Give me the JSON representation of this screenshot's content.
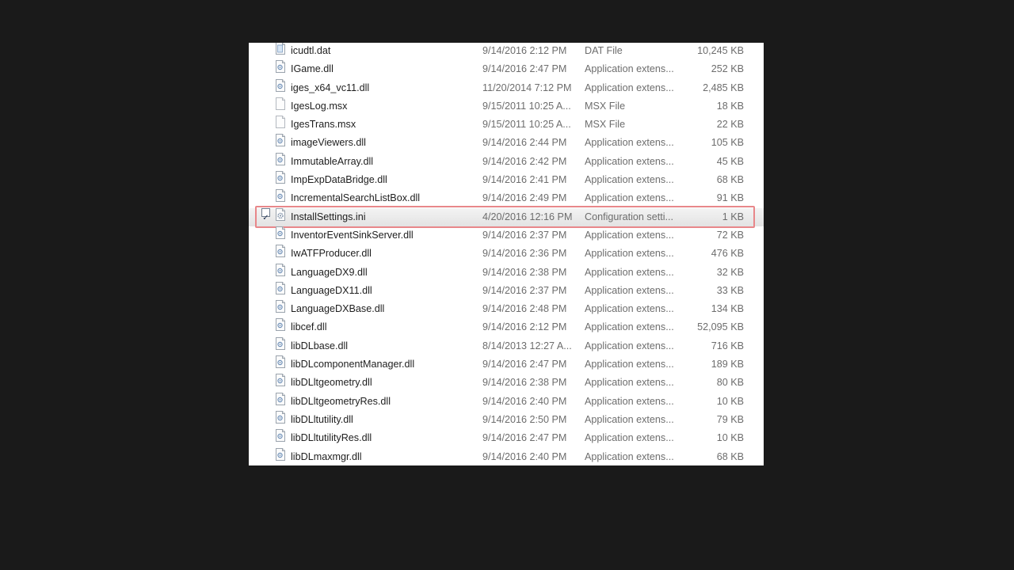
{
  "files": [
    {
      "name": "icudtl.dat",
      "date": "9/14/2016 2:12 PM",
      "type": "DAT File",
      "size": "10,245 KB",
      "icon": "dat-file-icon"
    },
    {
      "name": "IGame.dll",
      "date": "9/14/2016 2:47 PM",
      "type": "Application extens...",
      "size": "252 KB",
      "icon": "dll-file-icon"
    },
    {
      "name": "iges_x64_vc11.dll",
      "date": "11/20/2014 7:12 PM",
      "type": "Application extens...",
      "size": "2,485 KB",
      "icon": "dll-file-icon"
    },
    {
      "name": "IgesLog.msx",
      "date": "9/15/2011 10:25 A...",
      "type": "MSX File",
      "size": "18 KB",
      "icon": "blank-file-icon"
    },
    {
      "name": "IgesTrans.msx",
      "date": "9/15/2011 10:25 A...",
      "type": "MSX File",
      "size": "22 KB",
      "icon": "blank-file-icon"
    },
    {
      "name": "imageViewers.dll",
      "date": "9/14/2016 2:44 PM",
      "type": "Application extens...",
      "size": "105 KB",
      "icon": "dll-file-icon"
    },
    {
      "name": "ImmutableArray.dll",
      "date": "9/14/2016 2:42 PM",
      "type": "Application extens...",
      "size": "45 KB",
      "icon": "dll-file-icon"
    },
    {
      "name": "ImpExpDataBridge.dll",
      "date": "9/14/2016 2:41 PM",
      "type": "Application extens...",
      "size": "68 KB",
      "icon": "dll-file-icon"
    },
    {
      "name": "IncrementalSearchListBox.dll",
      "date": "9/14/2016 2:49 PM",
      "type": "Application extens...",
      "size": "91 KB",
      "icon": "dll-file-icon"
    },
    {
      "name": "InstallSettings.ini",
      "date": "4/20/2016 12:16 PM",
      "type": "Configuration setti...",
      "size": "1 KB",
      "icon": "ini-settings-file-icon",
      "selected": true,
      "checked": true
    },
    {
      "name": "InventorEventSinkServer.dll",
      "date": "9/14/2016 2:37 PM",
      "type": "Application extens...",
      "size": "72 KB",
      "icon": "dll-file-icon"
    },
    {
      "name": "IwATFProducer.dll",
      "date": "9/14/2016 2:36 PM",
      "type": "Application extens...",
      "size": "476 KB",
      "icon": "dll-file-icon"
    },
    {
      "name": "LanguageDX9.dll",
      "date": "9/14/2016 2:38 PM",
      "type": "Application extens...",
      "size": "32 KB",
      "icon": "dll-file-icon"
    },
    {
      "name": "LanguageDX11.dll",
      "date": "9/14/2016 2:37 PM",
      "type": "Application extens...",
      "size": "33 KB",
      "icon": "dll-file-icon"
    },
    {
      "name": "LanguageDXBase.dll",
      "date": "9/14/2016 2:48 PM",
      "type": "Application extens...",
      "size": "134 KB",
      "icon": "dll-file-icon"
    },
    {
      "name": "libcef.dll",
      "date": "9/14/2016 2:12 PM",
      "type": "Application extens...",
      "size": "52,095 KB",
      "icon": "dll-file-icon"
    },
    {
      "name": "libDLbase.dll",
      "date": "8/14/2013 12:27 A...",
      "type": "Application extens...",
      "size": "716 KB",
      "icon": "dll-file-icon"
    },
    {
      "name": "libDLcomponentManager.dll",
      "date": "9/14/2016 2:47 PM",
      "type": "Application extens...",
      "size": "189 KB",
      "icon": "dll-file-icon"
    },
    {
      "name": "libDLltgeometry.dll",
      "date": "9/14/2016 2:38 PM",
      "type": "Application extens...",
      "size": "80 KB",
      "icon": "dll-file-icon"
    },
    {
      "name": "libDLltgeometryRes.dll",
      "date": "9/14/2016 2:40 PM",
      "type": "Application extens...",
      "size": "10 KB",
      "icon": "dll-file-icon"
    },
    {
      "name": "libDLltutility.dll",
      "date": "9/14/2016 2:50 PM",
      "type": "Application extens...",
      "size": "79 KB",
      "icon": "dll-file-icon"
    },
    {
      "name": "libDLltutilityRes.dll",
      "date": "9/14/2016 2:47 PM",
      "type": "Application extens...",
      "size": "10 KB",
      "icon": "dll-file-icon"
    },
    {
      "name": "libDLmaxmgr.dll",
      "date": "9/14/2016 2:40 PM",
      "type": "Application extens...",
      "size": "68 KB",
      "icon": "dll-file-icon"
    }
  ],
  "colors": {
    "background": "#1a1a1a",
    "highlight_outline": "#e8878a",
    "selected_row": "#e9e9e9"
  }
}
